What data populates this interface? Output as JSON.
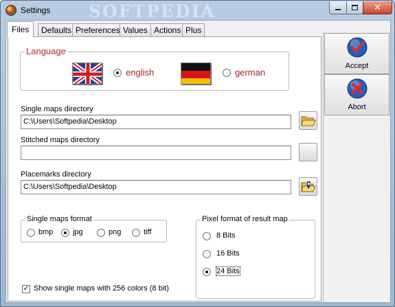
{
  "window": {
    "title": "Settings",
    "watermark": "SOFTPEDIA",
    "close_glyph": "✕"
  },
  "tabs": [
    {
      "label": "Files",
      "active": true
    },
    {
      "label": "Defaults",
      "active": false
    },
    {
      "label": "Preferences",
      "active": false
    },
    {
      "label": "Values",
      "active": false
    },
    {
      "label": "Actions",
      "active": false
    },
    {
      "label": "Plus",
      "active": false
    }
  ],
  "language": {
    "legend": "Language",
    "options": [
      {
        "label": "english",
        "flag": "uk-flag",
        "selected": true
      },
      {
        "label": "german",
        "flag": "germany-flag",
        "selected": false
      }
    ]
  },
  "directories": {
    "single_maps": {
      "label": "Single maps directory",
      "value": "C:\\Users\\Softpedia\\Desktop"
    },
    "stitched_maps": {
      "label": "Stitched maps directory",
      "value": ""
    },
    "placemarks": {
      "label": "Placemarks directory",
      "value": "C:\\Users\\Softpedia\\Desktop"
    }
  },
  "single_maps_format": {
    "legend": "Single maps format",
    "options": [
      {
        "label": "bmp",
        "selected": false
      },
      {
        "label": "jpg",
        "selected": true
      },
      {
        "label": "png",
        "selected": false
      },
      {
        "label": "tiff",
        "selected": false
      }
    ]
  },
  "pixel_format": {
    "legend": "Pixel format of result map",
    "options": [
      {
        "label": "8 Bits",
        "selected": false
      },
      {
        "label": "16 Bits",
        "selected": false
      },
      {
        "label": "24 Bits",
        "selected": true
      }
    ]
  },
  "show_256_colors": {
    "label": "Show single maps with 256 colors (8 bit)",
    "checked": true,
    "check_glyph": "✓"
  },
  "actions": {
    "accept_label": "Accept",
    "abort_label": "Abort"
  },
  "colors": {
    "accent_red": "#b0262c",
    "accept_icon": "#1f5fc0",
    "abort_icon": "#2a5fb8"
  }
}
